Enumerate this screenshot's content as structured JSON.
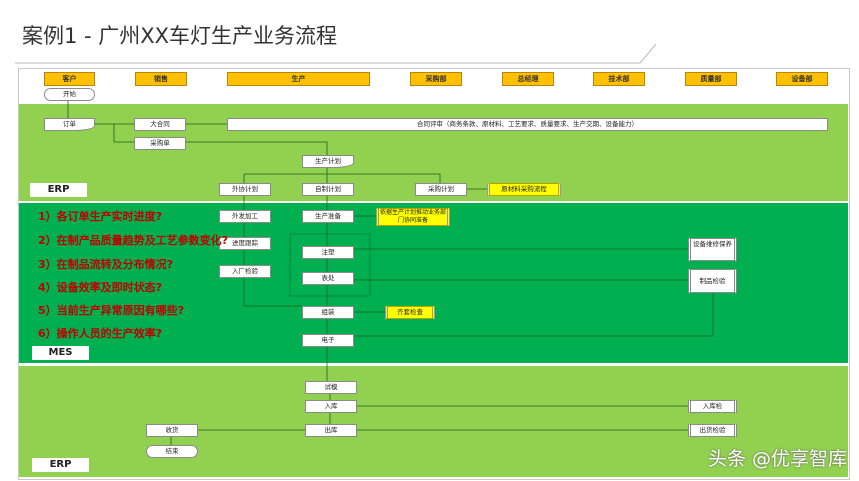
{
  "title": "案例1 - 广州XX车灯生产业务流程",
  "lanes": [
    "客户",
    "销售",
    "生产",
    "采购部",
    "总经理",
    "技术部",
    "质量部",
    "设备部"
  ],
  "nodes": {
    "start": "开始",
    "order": "订单",
    "big_contract": "大合同",
    "contract_review": "合同评审（商务条款、原材料、工艺要求、质量要求、生产交期、设备能力）",
    "purchase_order": "采购单",
    "production_plan": "生产计划",
    "outsource_plan": "外协计划",
    "self_plan": "自制计划",
    "procure_plan": "采购计划",
    "raw_material_flow": "原材料采购流程",
    "outsource_process": "外发加工",
    "production_prep": "生产准备",
    "prep_note": "依据生产计划推动业务部门协同准备",
    "progress_track": "进度跟踪",
    "incoming_inspect": "入厂检验",
    "injection": "注塑",
    "surface": "表处",
    "assembly": "组装",
    "kit_check": "齐套检查",
    "electronic": "电子",
    "equip_maint": "设备维修保养",
    "wip_inspect": "制品检验",
    "trial": "试模",
    "warehouse_in": "入库",
    "warehouse_out": "出库",
    "receive": "收货",
    "end": "结束",
    "in_inspect": "入库检",
    "ship_inspect": "出货检验"
  },
  "section_labels": {
    "erp_top": "ERP",
    "mes": "MES",
    "erp_bottom": "ERP"
  },
  "questions": [
    "1）各订单生产实时进度?",
    "2）在制产品质量趋势及工艺参数变化?",
    "3）在制品流转及分布情况?",
    "4）设备效率及即时状态?",
    "5）当前生产异常原因有哪些?",
    "6）操作人员的生产效率?"
  ],
  "watermark": "头条 @优享智库",
  "colors": {
    "erp": "#92d050",
    "mes": "#00b050",
    "lane": "#ffc000",
    "question": "#c00000",
    "note": "#ffff00"
  }
}
